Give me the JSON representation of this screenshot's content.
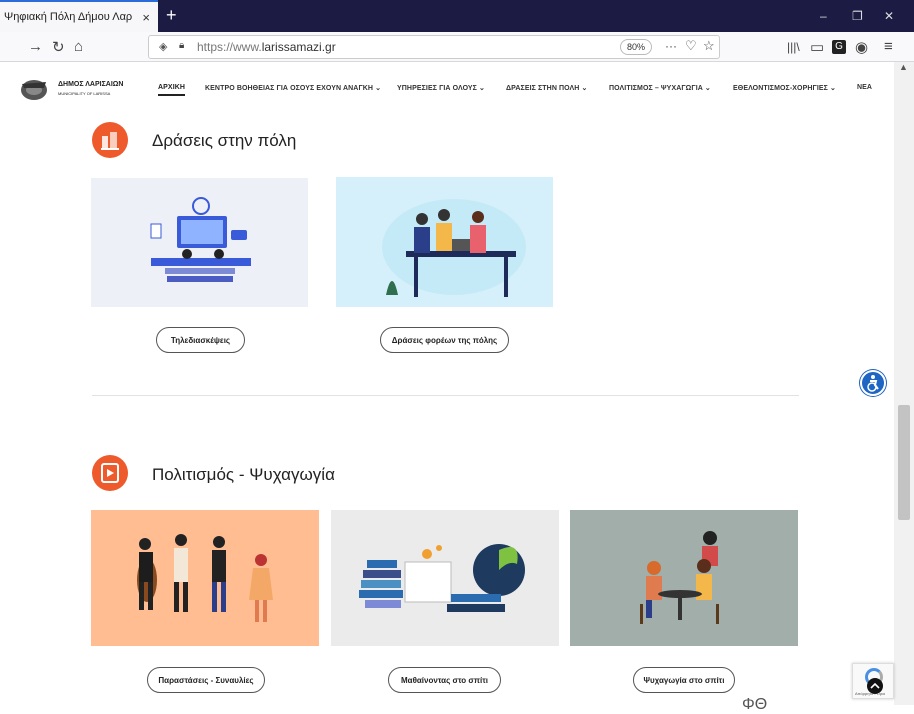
{
  "browser": {
    "tab_title": "Ψηφιακή Πόλη Δήμου Λαρισαίων",
    "tab_close": "×",
    "new_tab": "+",
    "url_secure": "https://www.",
    "url_domain": "larissamazi.gr",
    "zoom": "80%",
    "win_min": "–",
    "win_restore": "❐",
    "win_close": "✕"
  },
  "site": {
    "logo_title": "ΔΗΜΟΣ ΛΑΡΙΣΑΙΩΝ",
    "logo_sub": "MUNICIPALITY OF LARISSA",
    "menu": [
      {
        "label": "ΑΡΧΙΚΗ"
      },
      {
        "label": "ΚΕΝΤΡΟ ΒΟΗΘΕΙΑΣ ΓΙΑ ΟΣΟΥΣ ΕΧΟΥΝ ΑΝΑΓΚΗ ⌄"
      },
      {
        "label": "ΥΠΗΡΕΣΙΕΣ ΓΙΑ ΟΛΟΥΣ ⌄"
      },
      {
        "label": "ΔΡΑΣΕΙΣ ΣΤΗΝ ΠΟΛΗ ⌄"
      },
      {
        "label": "ΠΟΛΙΤΙΣΜΟΣ – ΨΥΧΑΓΩΓΙΑ ⌄"
      },
      {
        "label": "ΕΘΕΛΟΝΤΙΣΜΟΣ-ΧΟΡΗΓΙΕΣ ⌄"
      },
      {
        "label": "ΝΕΑ"
      }
    ]
  },
  "sections": [
    {
      "title": "Δράσεις στην πόλη",
      "cards": [
        {
          "button": "Τηλεδιασκέψεις"
        },
        {
          "button": "Δράσεις φορέων της πόλης"
        }
      ]
    },
    {
      "title": "Πολιτισμός - Ψυχαγωγία",
      "cards": [
        {
          "button": "Παραστάσεις - Συναυλίες"
        },
        {
          "button": "Μαθαίνοντας στο σπίτι"
        },
        {
          "button": "Ψυχαγωγία στο σπίτι"
        }
      ]
    }
  ],
  "recaptcha_text": "Απόρρητο - Όροι",
  "partial_bottom": "ΦΘ",
  "colors": {
    "accent": "#ee5a2b",
    "card1": "#edf0f6",
    "card2": "#d6f0fb",
    "card3": "#ffbd91",
    "card4": "#ebebeb",
    "card5": "#a1aeaa",
    "access": "#1e65c4"
  },
  "icons": [
    "back-icon",
    "forward-icon",
    "reload-icon",
    "home-icon",
    "shield-icon",
    "lock-icon",
    "more-icon",
    "pocket-icon",
    "star-icon",
    "library-icon",
    "sidebar-icon",
    "extension-icon",
    "account-icon",
    "menu-icon",
    "accessibility-icon"
  ]
}
